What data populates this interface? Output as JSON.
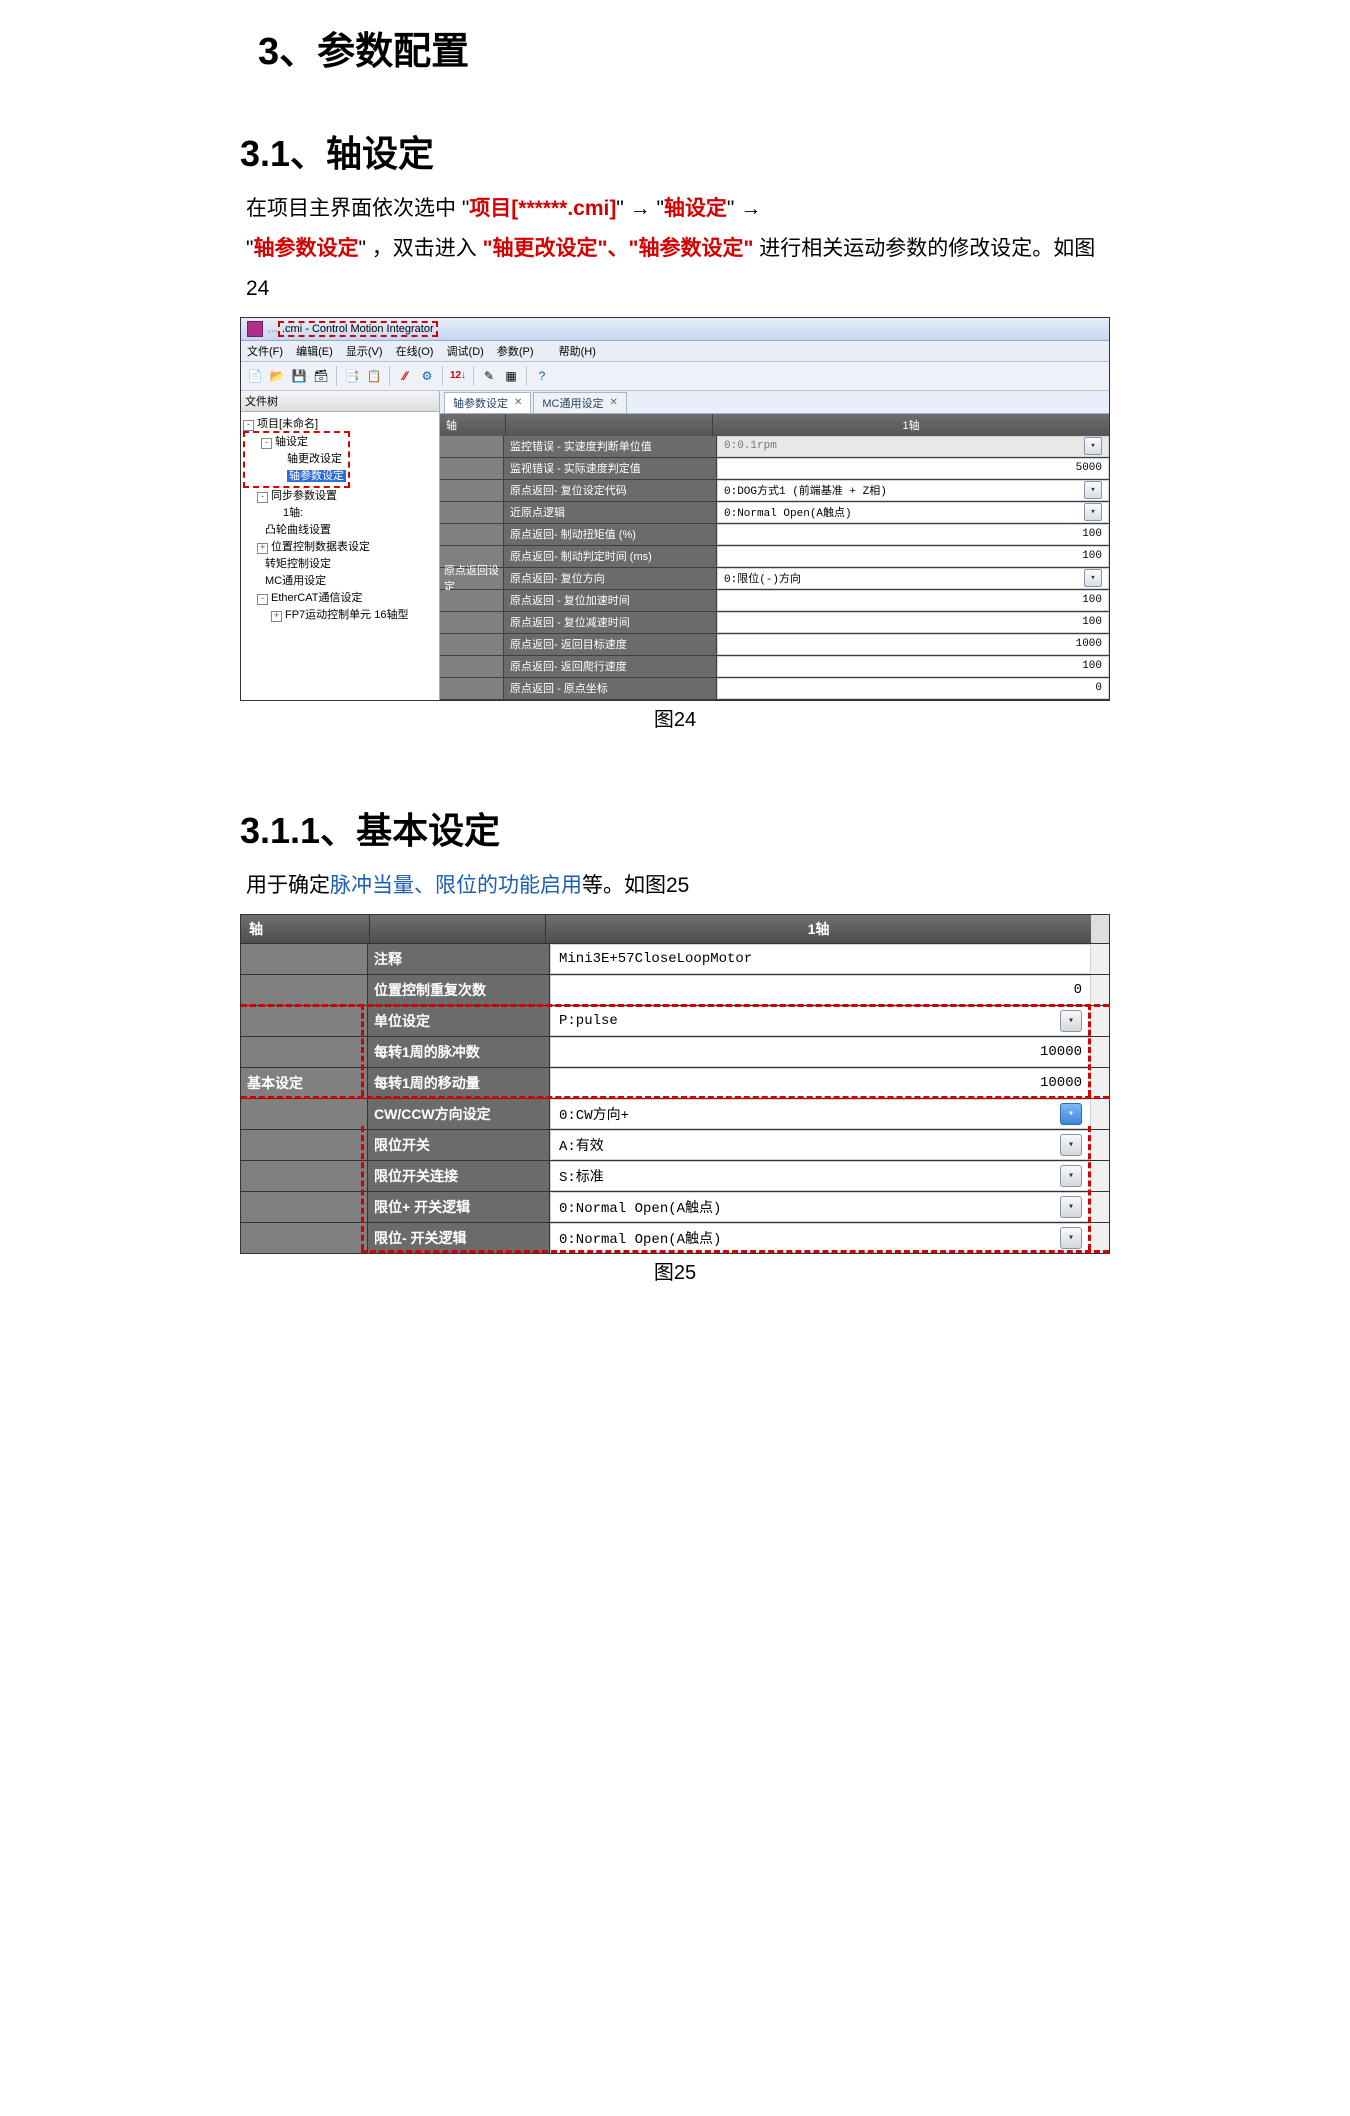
{
  "h1": "3、参数配置",
  "h2": "3.1、轴设定",
  "para1_a": "在项目主界面依次选中 \"",
  "para1_b": "项目[******.cmi]",
  "para1_c": "\" → \"",
  "para1_d": "轴设定",
  "para1_e": "\" →",
  "para2_a": "\"",
  "para2_b": "轴参数设定",
  "para2_c": "\" ，双击进入 ",
  "para2_d": "\"轴更改设定\"",
  "para2_e": "、",
  "para2_f": "\"轴参数设定\"",
  "para2_g": " 进行相关运动参数的修改设定。如图24",
  "cap24": "图24",
  "title24_blur": "…",
  "title24": ".cmi - Control Motion Integrator",
  "menu": [
    "文件(F)",
    "编辑(E)",
    "显示(V)",
    "在线(O)",
    "调试(D)",
    "参数(P)",
    "帮助(H)"
  ],
  "tree_head": "文件树",
  "tree": {
    "proj": "项目[未命名]",
    "axis": "轴设定",
    "axis_change": "轴更改设定",
    "axis_param": "轴参数设定",
    "sync": "同步参数设置",
    "axis1": "1轴:",
    "cam": "凸轮曲线设置",
    "posdata": "位置控制数据表设定",
    "torque": "转矩控制设定",
    "mc": "MC通用设定",
    "ecat": "EtherCAT通信设定",
    "fp7": "FP7运动控制单元 16轴型"
  },
  "tabs": {
    "t1": "轴参数设定",
    "t2": "MC通用设定"
  },
  "grid24_head_a": "轴",
  "grid24_head_b": "1轴",
  "grid24_group_origin": "原点返回设定",
  "grid24_rows": [
    {
      "b": "监控错误 - 实速度判断单位值",
      "v": "0:0.1rpm",
      "type": "ro"
    },
    {
      "b": "监视错误 - 实际速度判定值",
      "v": "5000",
      "type": "num"
    },
    {
      "b": "原点返回- 复位设定代码",
      "v": "0:DOG方式1 (前端基准 + Z相)",
      "type": "dd"
    },
    {
      "b": "近原点逻辑",
      "v": "0:Normal Open(A触点)",
      "type": "dd"
    },
    {
      "b": "原点返回- 制动扭矩值 (%)",
      "v": "100",
      "type": "num"
    },
    {
      "b": "原点返回- 制动判定时间 (ms)",
      "v": "100",
      "type": "num"
    },
    {
      "b": "原点返回- 复位方向",
      "v": "0:限位(-)方向",
      "type": "dd"
    },
    {
      "b": "原点返回 - 复位加速时间",
      "v": "100",
      "type": "num"
    },
    {
      "b": "原点返回 - 复位减速时间",
      "v": "100",
      "type": "num"
    },
    {
      "b": "原点返回- 返回目标速度",
      "v": "1000",
      "type": "num"
    },
    {
      "b": "原点返回- 返回爬行速度",
      "v": "100",
      "type": "num"
    },
    {
      "b": "原点返回 - 原点坐标",
      "v": "0",
      "type": "num"
    }
  ],
  "h3": "3.1.1、基本设定",
  "para3_a": "用于确定",
  "para3_b": "脉冲当量、限位的功能启用",
  "para3_c": "等。如图25",
  "cap25": "图25",
  "t25_head_a": "轴",
  "t25_head_b": "1轴",
  "t25_group": "基本设定",
  "t25_rows": [
    {
      "b": "注释",
      "v": "Mini3E+57CloseLoopMotor",
      "type": "txt"
    },
    {
      "b": "位置控制重复次数",
      "v": "0",
      "type": "num"
    },
    {
      "b": "单位设定",
      "v": "P:pulse",
      "type": "dd",
      "hi": true
    },
    {
      "b": "每转1周的脉冲数",
      "v": "10000",
      "type": "num",
      "hi": true
    },
    {
      "b": "每转1周的移动量",
      "v": "10000",
      "type": "num",
      "hi": true
    },
    {
      "b": "CW/CCW方向设定",
      "v": "0:CW方向+",
      "type": "ddb"
    },
    {
      "b": "限位开关",
      "v": "A:有效",
      "type": "dd",
      "hi2": true
    },
    {
      "b": "限位开关连接",
      "v": "S:标准",
      "type": "dd",
      "hi2": true
    },
    {
      "b": "限位+ 开关逻辑",
      "v": "0:Normal Open(A触点)",
      "type": "dd",
      "hi2": true
    },
    {
      "b": "限位- 开关逻辑",
      "v": "0:Normal Open(A触点)",
      "type": "dd",
      "hi2": true
    }
  ]
}
